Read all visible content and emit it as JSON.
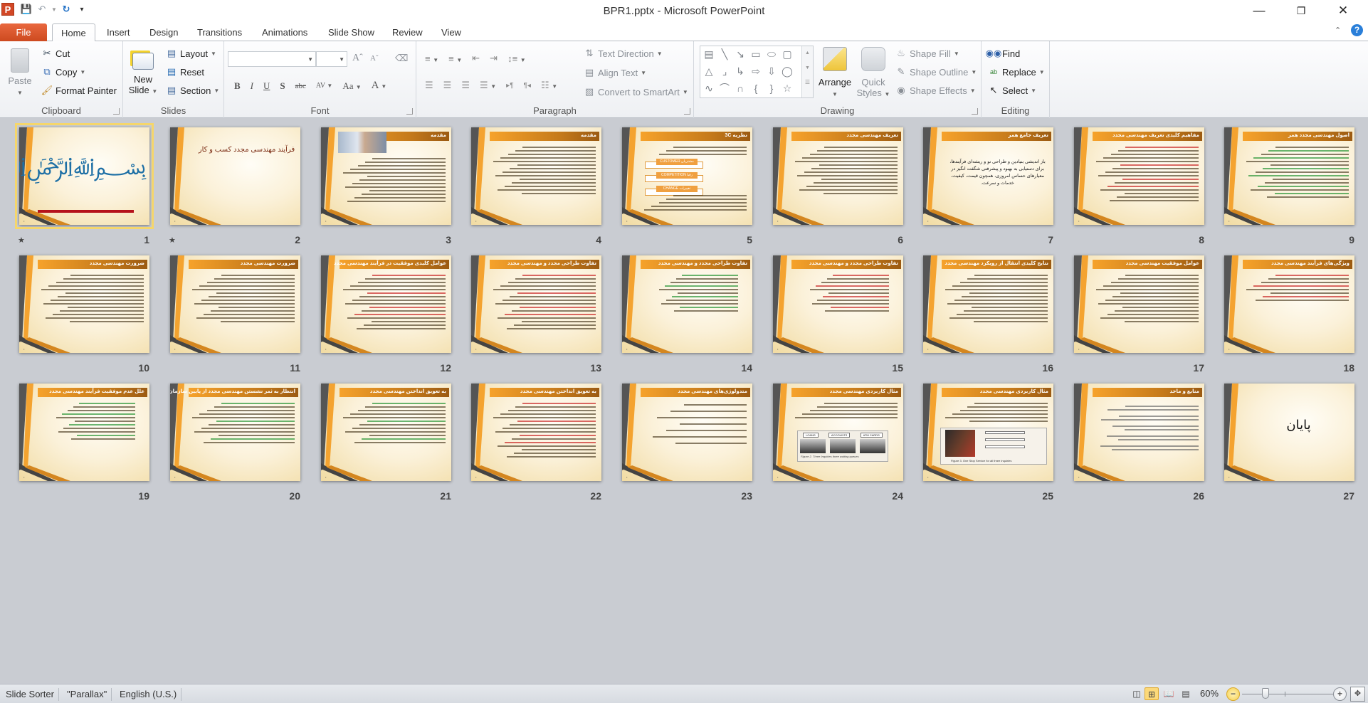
{
  "window": {
    "title": "BPR1.pptx - Microsoft PowerPoint",
    "minimize_icon": "minimize-icon",
    "restore_icon": "restore-icon",
    "close_icon": "close-icon"
  },
  "quick_access": {
    "app_logo": "P",
    "items": [
      "save-icon",
      "undo-icon",
      "redo-icon",
      "customize-icon"
    ]
  },
  "tabs": [
    {
      "label": "File"
    },
    {
      "label": "Home",
      "active": true
    },
    {
      "label": "Insert"
    },
    {
      "label": "Design"
    },
    {
      "label": "Transitions"
    },
    {
      "label": "Animations"
    },
    {
      "label": "Slide Show"
    },
    {
      "label": "Review"
    },
    {
      "label": "View"
    }
  ],
  "ribbon": {
    "clipboard": {
      "label": "Clipboard",
      "paste": "Paste",
      "cut": "Cut",
      "copy": "Copy",
      "format_painter": "Format Painter"
    },
    "slides": {
      "label": "Slides",
      "new_slide_line1": "New",
      "new_slide_line2": "Slide",
      "layout": "Layout",
      "reset": "Reset",
      "section": "Section"
    },
    "font": {
      "label": "Font",
      "font_name_value": "",
      "font_size_value": "",
      "buttons": [
        "B",
        "I",
        "U",
        "S",
        "abc",
        "AV",
        "Aa",
        "A"
      ]
    },
    "paragraph": {
      "label": "Paragraph",
      "text_direction": "Text Direction",
      "align_text": "Align Text",
      "convert_smartart": "Convert to SmartArt"
    },
    "drawing": {
      "label": "Drawing",
      "arrange": "Arrange",
      "quick_styles_line1": "Quick",
      "quick_styles_line2": "Styles",
      "shape_fill": "Shape Fill",
      "shape_outline": "Shape Outline",
      "shape_effects": "Shape Effects"
    },
    "editing": {
      "label": "Editing",
      "find": "Find",
      "replace": "Replace",
      "select": "Select"
    }
  },
  "slides": [
    {
      "num": "1",
      "kind": "bismillah",
      "selected": true,
      "transition_icon": true
    },
    {
      "num": "2",
      "kind": "title",
      "title": "فرآیند مهندسی مجدد کسب و کار",
      "transition_icon": true
    },
    {
      "num": "3",
      "kind": "photo-text",
      "title": "مقدمه",
      "body": "مایکل همر (MICHAEL HAMMER) ... (REENGINEERING)"
    },
    {
      "num": "4",
      "kind": "text",
      "title": "مقدمه"
    },
    {
      "num": "5",
      "kind": "3c",
      "title": "نظریه 3C",
      "boxes": [
        "CUSTOMER مشتریان",
        "COMPETITION رقبا",
        "CHANGE تغییرات"
      ]
    },
    {
      "num": "6",
      "kind": "text",
      "title": "تعریف مهندسی مجدد"
    },
    {
      "num": "7",
      "kind": "quote",
      "title": "تعریف جامع همر",
      "quote": "باز اندیشی بنیادین و طراحی نو و ریشه‌ای فرآیندها، برای دستیابی به بهبود و پیشرفتی شگفت انگیز در معیارهای حساس امروزی، همچون قیمت، کیفیت، خدمات و سرعت."
    },
    {
      "num": "8",
      "kind": "text-colored",
      "title": "مفاهیم کلیدی تعریف مهندسی مجدد"
    },
    {
      "num": "9",
      "kind": "list-green",
      "title": "اصول مهندسی مجدد همر"
    },
    {
      "num": "10",
      "kind": "text",
      "title": "ضرورت مهندسی مجدد"
    },
    {
      "num": "11",
      "kind": "text",
      "title": "ضرورت مهندسی مجدد"
    },
    {
      "num": "12",
      "kind": "text-colored",
      "title": "عوامل کلیدی موفقیت در فرآیند مهندسی مجدد"
    },
    {
      "num": "13",
      "kind": "text-colored",
      "title": "تفاوت طراحی مجدد و مهندسی مجدد"
    },
    {
      "num": "14",
      "kind": "checklist",
      "title": "تفاوت طراحی مجدد و مهندسی مجدد",
      "subtitle": "طراحی مجدد فرآیند"
    },
    {
      "num": "15",
      "kind": "checklist-red",
      "title": "تفاوت طراحی مجدد و مهندسی مجدد",
      "subtitle": "مهندسی مجدد فرآیند"
    },
    {
      "num": "16",
      "kind": "list",
      "title": "نتایج کلیدی انتقال از رویکرد مهندسی مجدد"
    },
    {
      "num": "17",
      "kind": "list",
      "title": "عوامل موفقیت مهندسی مجدد"
    },
    {
      "num": "18",
      "kind": "list-red",
      "title": "ویژگی‌های فرآیند مهندسی مجدد"
    },
    {
      "num": "19",
      "kind": "checklist",
      "title": "علل عدم موفقیت فرآیند مهندسی مجدد"
    },
    {
      "num": "20",
      "kind": "text-green",
      "title": "انتظار به ثمر نشستن مهندسی مجدد از پایین سازمان"
    },
    {
      "num": "21",
      "kind": "text-green",
      "title": "به تعویق انداختن مهندسی مجدد"
    },
    {
      "num": "22",
      "kind": "text-colored",
      "title": "به تعویق انداختن مهندسی مجدد"
    },
    {
      "num": "23",
      "kind": "methods",
      "title": "متدولوژی‌های مهندسی مجدد",
      "items": [
        "متدولوژی مهندسی مجدد کتینگر (1994Kettinger)",
        "متدولوژی مهندسی مجدد فورتی (1993Furey)",
        "متدولوژی مهندسی مجدد گاها (1993Guha)",
        "متدولوژی مهندسی مجدد جوهانسون (1993Johansson)",
        "متدولوژی مهندسی مجدد پتروزو و استپر (1994Petrozzo & Stepper)",
        "متدولوژی مهندسی مجدد شورت و داونپورت (1990Short & Davenport)",
        "متدولوژی مهندسی مجدد پرت و هاریسون (1993Pratt & Harrison)"
      ]
    },
    {
      "num": "24",
      "kind": "figure1",
      "title": "مثال کاربردی مهندسی مجدد",
      "figure_labels": [
        "LOANS",
        "ACCOUNTS",
        "ATM CARDS"
      ],
      "caption": "Figure 2. Three Inquiries three waiting queues"
    },
    {
      "num": "25",
      "kind": "figure2",
      "title": "مثال کاربردی مهندسی مجدد",
      "caption": "Figure 3. One Stop Service for all three inquiries"
    },
    {
      "num": "26",
      "kind": "refs",
      "title": "منابع و ماخذ",
      "refs": [
        "BPR, Available at: www.solutionsformanagement.com/BPR.htm",
        "Manganelli. R, Klein. M, (1994), \"A step-by-step guide to business transformation\" New York: AMACOM",
        "Peppard. J & Rowland. P (1995) \"The essence of business process reengineering\", UK: Prentice Hall"
      ]
    },
    {
      "num": "27",
      "kind": "end",
      "title": "پایان"
    }
  ],
  "statusbar": {
    "view_name": "Slide Sorter",
    "theme": "\"Parallax\"",
    "language": "English (U.S.)",
    "zoom": "60%",
    "zoom_level_percent": 60
  }
}
